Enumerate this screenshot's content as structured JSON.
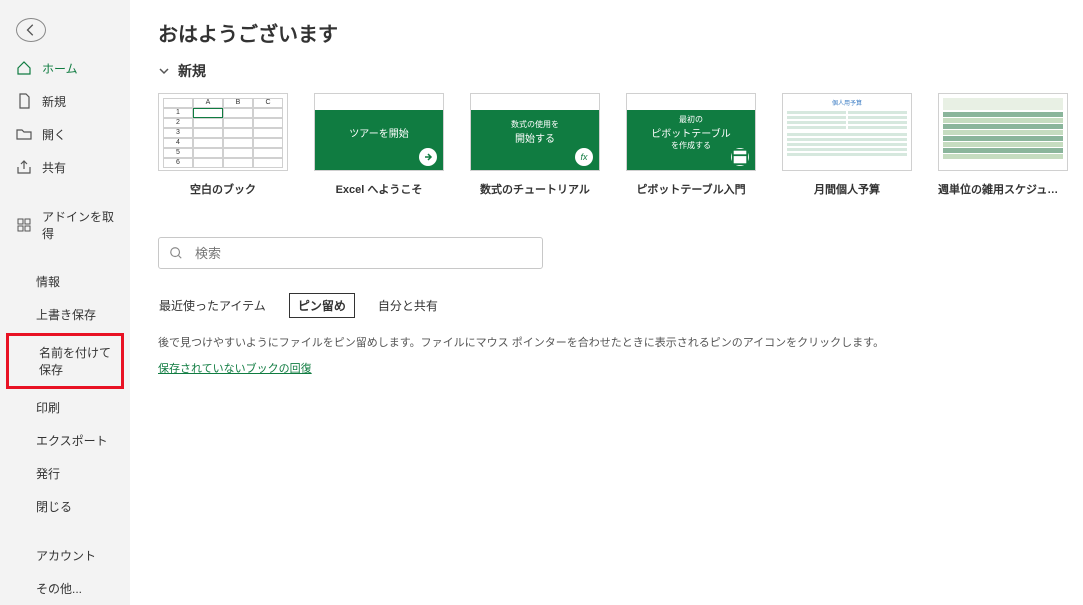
{
  "greeting": "おはようございます",
  "sidebar": {
    "items": [
      {
        "label": "ホーム",
        "icon": "home"
      },
      {
        "label": "新規",
        "icon": "file"
      },
      {
        "label": "開く",
        "icon": "folder"
      },
      {
        "label": "共有",
        "icon": "share"
      }
    ],
    "addins": "アドインを取得",
    "menu": [
      "情報",
      "上書き保存",
      "名前を付けて保存",
      "印刷",
      "エクスポート",
      "発行",
      "閉じる"
    ],
    "account": "アカウント",
    "other": "その他..."
  },
  "section_new": "新規",
  "templates": [
    {
      "label": "空白のブック",
      "kind": "blank"
    },
    {
      "label": "Excel へようこそ",
      "kind": "green",
      "text": "ツアーを開始",
      "badge": "arrow"
    },
    {
      "label": "数式のチュートリアル",
      "kind": "green",
      "text1": "数式の使用を",
      "text2": "開始する",
      "badge": "fx"
    },
    {
      "label": "ピボットテーブル入門",
      "kind": "green",
      "text1": "最初の",
      "text2": "ピボットテーブル",
      "text3": "を作成する",
      "badge": "pivot"
    },
    {
      "label": "月間個人予算",
      "kind": "budget"
    },
    {
      "label": "週単位の雑用スケジュール (ブ…",
      "kind": "schedule"
    }
  ],
  "search": {
    "placeholder": "検索"
  },
  "tabs": {
    "recent": "最近使ったアイテム",
    "pinned": "ピン留め",
    "shared": "自分と共有"
  },
  "hint": "後で見つけやすいようにファイルをピン留めします。ファイルにマウス ポインターを合わせたときに表示されるピンのアイコンをクリックします。",
  "recover": "保存されていないブックの回復"
}
